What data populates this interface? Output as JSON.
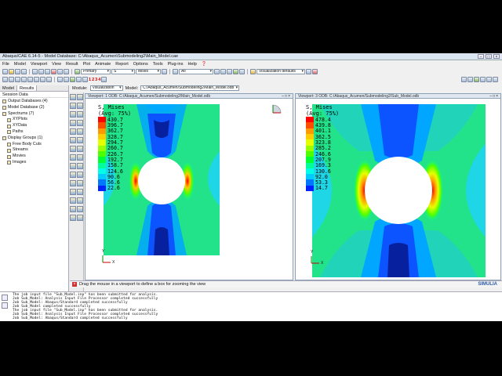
{
  "window": {
    "title": "Abaqus/CAE 6.14-5 - Model Database: C:\\Abaqus_Acumen\\Submodeling2\\Main_Model.cae"
  },
  "menu": [
    "File",
    "Model",
    "Viewport",
    "View",
    "Result",
    "Plot",
    "Animate",
    "Report",
    "Options",
    "Tools",
    "Plug-ins",
    "Help",
    "❓"
  ],
  "toolbar": {
    "primary_select": "Primary",
    "variable_select": "S",
    "invariant_select": "Mises",
    "filter_select": "All",
    "visualization_defaults": "Visualization defaults",
    "step_numbers": [
      "1",
      "2",
      "3",
      "4"
    ]
  },
  "context": {
    "module_label": "Module:",
    "module_value": "Visualization",
    "model_label": "Model:",
    "model_value": "C:/Abaqus_Acumen/Submodeling2/Main_Model.odb"
  },
  "left_panel": {
    "tabs": [
      "Model",
      "Results"
    ],
    "session_label": "Session Data",
    "tree": [
      "Output Databases (4)",
      "Model Database (2)",
      "Spectrums (7)",
      "XYPlots",
      "XYData",
      "Paths",
      "Display Groups (1)",
      "Free Body Cuts",
      "Streams",
      "Movies",
      "Images"
    ]
  },
  "viewport1": {
    "title": "Viewport: 1     ODB: C:/Abaqus_Acumen/Submodeling2/Main_Model.odb",
    "legend_title": "S, Mises",
    "legend_avg": "(Avg: 75%)",
    "values": [
      "430.7",
      "396.7",
      "362.7",
      "328.7",
      "294.7",
      "260.7",
      "226.7",
      "192.7",
      "158.7",
      "124.6",
      "90.6",
      "56.6",
      "22.6"
    ],
    "axis_x": "X",
    "axis_y": "Y"
  },
  "viewport3": {
    "title": "Viewport: 3     ODB: C:/Abaqus_Acumen/Submodeling2/Sub_Model.odb",
    "legend_title": "S, Mises",
    "legend_avg": "(Avg: 75%)",
    "values": [
      "478.4",
      "439.8",
      "401.1",
      "362.5",
      "323.8",
      "285.2",
      "246.6",
      "207.9",
      "169.3",
      "130.6",
      "92.0",
      "53.3",
      "14.7"
    ],
    "axis_x": "X",
    "axis_y": "Y"
  },
  "legend_colors": [
    "#ff0000",
    "#ff4d00",
    "#ff9900",
    "#ffcc00",
    "#e6ff00",
    "#99ff00",
    "#4dff00",
    "#00ff33",
    "#00ff99",
    "#00ffe6",
    "#00ccff",
    "#0077ff",
    "#0022ff"
  ],
  "prompt": "Drag the mouse in a viewport to define a box for zooming the view",
  "brand": "SIMULIA",
  "messages": [
    "The job input file \"Sub_Model.inp\" has been submitted for analysis.",
    "Job Sub_Model: Analysis Input File Processor completed successfully",
    "Job Sub_Model: Abaqus/Standard completed successfully",
    "Job Sub_Model completed successfully",
    "The job input file \"Sub_Model.inp\" has been submitted for analysis.",
    "Job Sub_Model: Analysis Input File Processor completed successfully",
    "Job Sub_Model: Abaqus/Standard completed successfully",
    "Job Sub_Model completed successfully"
  ]
}
